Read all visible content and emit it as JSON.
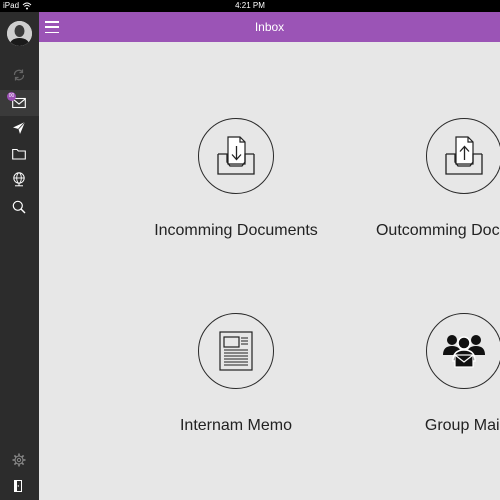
{
  "status_bar": {
    "device": "iPad",
    "time": "4:21 PM"
  },
  "sidebar": {
    "badge": "00",
    "items": [
      {
        "icon": "refresh-icon"
      },
      {
        "icon": "mail-icon"
      },
      {
        "icon": "send-icon"
      },
      {
        "icon": "folder-icon"
      },
      {
        "icon": "globe-icon"
      },
      {
        "icon": "search-icon"
      },
      {
        "icon": "gear-icon"
      },
      {
        "icon": "logout-icon"
      }
    ]
  },
  "header": {
    "title": "Inbox"
  },
  "tiles": [
    {
      "label": "Incomming Documents",
      "icon": "incoming-document-icon"
    },
    {
      "label": "Outcomming Documents",
      "icon": "outgoing-document-icon"
    },
    {
      "label": "Internam Memo",
      "icon": "memo-icon"
    },
    {
      "label": "Group Mail",
      "icon": "group-mail-icon"
    }
  ],
  "colors": {
    "header": "#9b54b6",
    "sidebar": "#2c2c2c",
    "background": "#e7e7e7",
    "badge": "#9b4fb5"
  }
}
